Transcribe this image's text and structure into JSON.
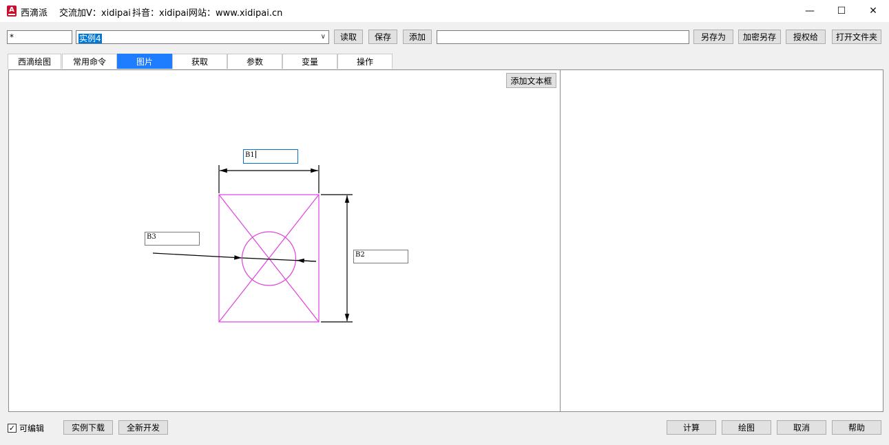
{
  "window": {
    "app_name": "西滴派",
    "info": "交流加V：xidipai",
    "douyin": "抖音：xidipai",
    "website": "网站：www.xidipai.cn",
    "icon_letter": "A",
    "minimize_glyph": "—",
    "maximize_glyph": "☐",
    "close_glyph": "✕"
  },
  "toolbar": {
    "filter_value": "*",
    "combo_value": "实例4",
    "combo_arrow": "∨",
    "read_label": "读取",
    "save_label": "保存",
    "add_label": "添加",
    "path_value": "",
    "save_as_label": "另存为",
    "encrypt_save_label": "加密另存",
    "authorize_label": "授权给",
    "open_folder_label": "打开文件夹"
  },
  "tabs": [
    {
      "label": "西滴绘图",
      "active": false
    },
    {
      "label": "常用命令",
      "active": false
    },
    {
      "label": "图片",
      "active": true
    },
    {
      "label": "获取",
      "active": false
    },
    {
      "label": "参数",
      "active": false
    },
    {
      "label": "变量",
      "active": false
    },
    {
      "label": "操作",
      "active": false
    }
  ],
  "canvas": {
    "add_textbox_label": "添加文本框",
    "textboxes": {
      "b1": "B1",
      "b2": "B2",
      "b3": "B3"
    },
    "colors": {
      "shape": "#e040e0",
      "dimension": "#000000"
    }
  },
  "footer": {
    "editable_label": "可编辑",
    "editable_checked": true,
    "check_glyph": "✓",
    "download_label": "实例下载",
    "new_dev_label": "全新开发",
    "calc_label": "计算",
    "draw_label": "绘图",
    "cancel_label": "取消",
    "help_label": "帮助"
  }
}
